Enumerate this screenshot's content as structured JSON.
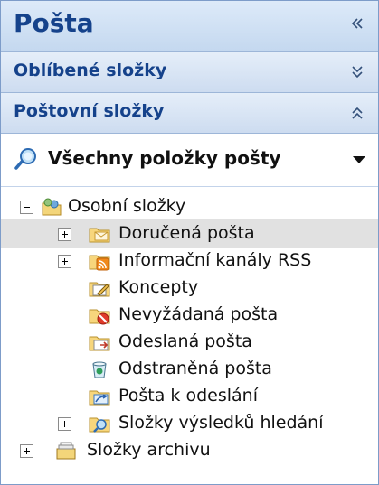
{
  "pane": {
    "title": "Pošta",
    "collapse_glyph": "«"
  },
  "sections": {
    "favorites": {
      "label": "Oblíbené složky",
      "chevron": "double-down"
    },
    "mail_folders": {
      "label": "Poštovní složky",
      "chevron": "double-up"
    }
  },
  "filter": {
    "label": "Všechny položky pošty"
  },
  "tree": {
    "root": "Osobní složky",
    "items": [
      {
        "label": "Doručená pošta",
        "icon": "inbox-folder-icon",
        "expander": "plus",
        "selected": true
      },
      {
        "label": "Informační kanály RSS",
        "icon": "rss-folder-icon",
        "expander": "plus"
      },
      {
        "label": "Koncepty",
        "icon": "drafts-folder-icon"
      },
      {
        "label": "Nevyžádaná pošta",
        "icon": "junk-folder-icon"
      },
      {
        "label": "Odeslaná pošta",
        "icon": "sent-folder-icon"
      },
      {
        "label": "Odstraněná pošta",
        "icon": "deleted-items-icon"
      },
      {
        "label": "Pošta k odeslání",
        "icon": "outbox-folder-icon"
      },
      {
        "label": "Složky výsledků hledání",
        "icon": "search-folders-icon",
        "expander": "plus"
      }
    ],
    "archive": "Složky archivu"
  },
  "colors": {
    "header_text": "#15428b",
    "selected_row": "#e1e1e1",
    "border": "#7d9cc9"
  }
}
